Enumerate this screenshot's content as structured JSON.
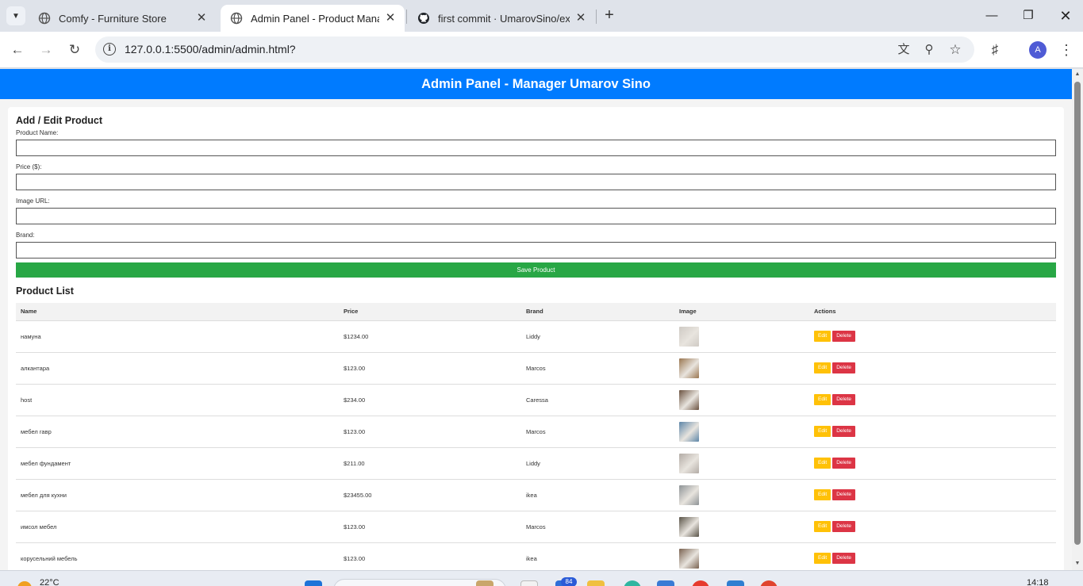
{
  "browser": {
    "tabs": [
      {
        "title": "Comfy - Furniture Store",
        "active": false,
        "favicon": "globe-icon"
      },
      {
        "title": "Admin Panel - Product Manage",
        "active": true,
        "favicon": "globe-icon"
      },
      {
        "title": "first commit · UmarovSino/exan",
        "active": false,
        "favicon": "github-icon"
      }
    ],
    "url": "127.0.0.1:5500/admin/admin.html?",
    "profile_initial": "A"
  },
  "page": {
    "header": "Admin Panel - Manager Umarov Sino",
    "form": {
      "title": "Add / Edit Product",
      "fields": [
        {
          "label": "Product Name:",
          "value": ""
        },
        {
          "label": "Price ($):",
          "value": ""
        },
        {
          "label": "Image URL:",
          "value": ""
        },
        {
          "label": "Brand:",
          "value": ""
        }
      ],
      "save_label": "Save Product"
    },
    "list": {
      "title": "Product List",
      "columns": [
        "Name",
        "Price",
        "Brand",
        "Image",
        "Actions"
      ],
      "edit_label": "Edit",
      "delete_label": "Delete",
      "rows": [
        {
          "name": "намуна",
          "price": "$1234.00",
          "brand": "Liddy",
          "img_color": "#cfcac4"
        },
        {
          "name": "алкантара",
          "price": "$123.00",
          "brand": "Marcos",
          "img_color": "#9a7650"
        },
        {
          "name": "host",
          "price": "$234.00",
          "brand": "Caressa",
          "img_color": "#6b5240"
        },
        {
          "name": "мебел гавр",
          "price": "$123.00",
          "brand": "Marcos",
          "img_color": "#5d86a8"
        },
        {
          "name": "мебел фундамент",
          "price": "$211.00",
          "brand": "Liddy",
          "img_color": "#b3aca6"
        },
        {
          "name": "мебел для кухни",
          "price": "$23455.00",
          "brand": "ikea",
          "img_color": "#8e9396"
        },
        {
          "name": "имсол мебел",
          "price": "$123.00",
          "brand": "Marcos",
          "img_color": "#5a5448"
        },
        {
          "name": "корусельний мебель",
          "price": "$123.00",
          "brand": "ikea",
          "img_color": "#7a6250"
        }
      ]
    }
  },
  "taskbar": {
    "temperature": "22°C",
    "notification_count": "84",
    "time": "14:18"
  },
  "colors": {
    "header_blue": "#007bff",
    "save_green": "#28a745",
    "edit_yellow": "#ffc107",
    "delete_red": "#dc3545"
  }
}
